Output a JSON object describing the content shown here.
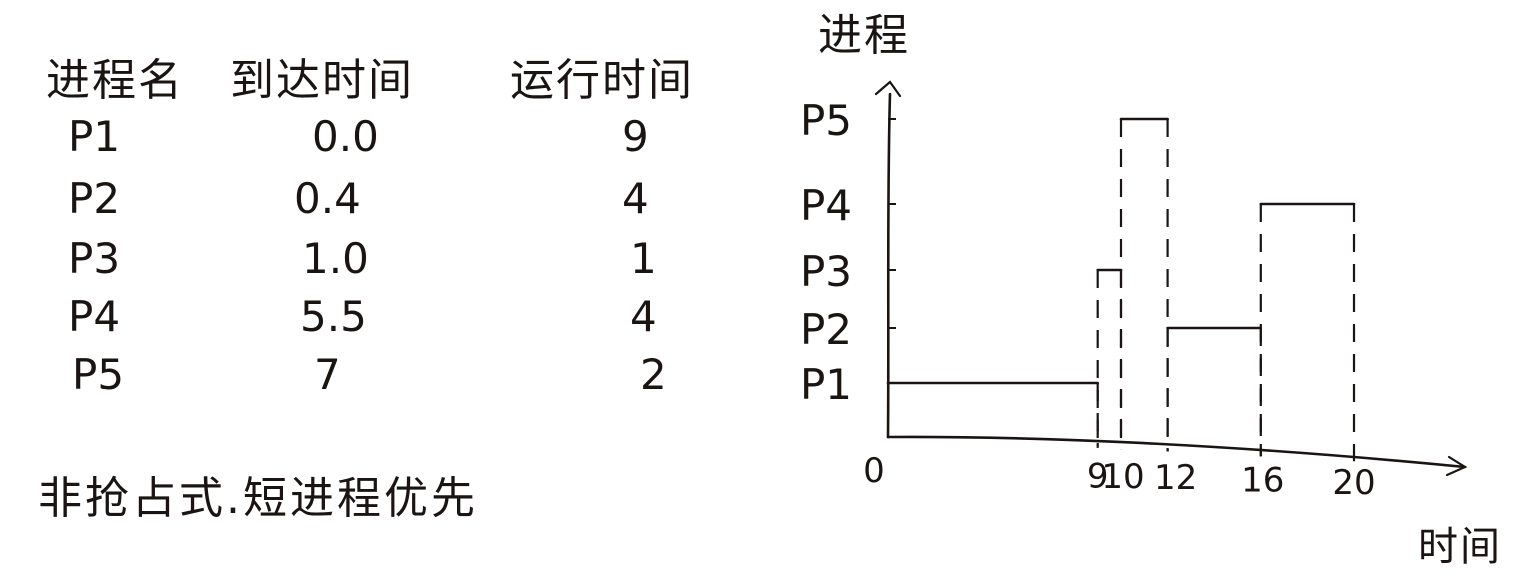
{
  "table": {
    "headers": {
      "process_name": "进程名",
      "arrival_time": "到达时间",
      "run_time": "运行时间"
    },
    "rows": [
      {
        "name": "P1",
        "arrival": "0.0",
        "run": "9"
      },
      {
        "name": "P2",
        "arrival": "0.4",
        "run": "4"
      },
      {
        "name": "P3",
        "arrival": "1.0",
        "run": "1"
      },
      {
        "name": "P4",
        "arrival": "5.5",
        "run": "4"
      },
      {
        "name": "P5",
        "arrival": "7",
        "run": "2"
      }
    ]
  },
  "note": "非抢占式.短进程优先",
  "chart_data": {
    "type": "gantt",
    "ylabel": "进程",
    "xlabel": "时间",
    "categories": [
      "P1",
      "P2",
      "P3",
      "P4",
      "P5"
    ],
    "x_ticks": [
      "0",
      "9",
      "10",
      "12",
      "16",
      "20"
    ],
    "segments": [
      {
        "process": "P1",
        "start": 0,
        "end": 9
      },
      {
        "process": "P3",
        "start": 9,
        "end": 10
      },
      {
        "process": "P5",
        "start": 10,
        "end": 12
      },
      {
        "process": "P2",
        "start": 12,
        "end": 16
      },
      {
        "process": "P4",
        "start": 16,
        "end": 20
      }
    ]
  }
}
